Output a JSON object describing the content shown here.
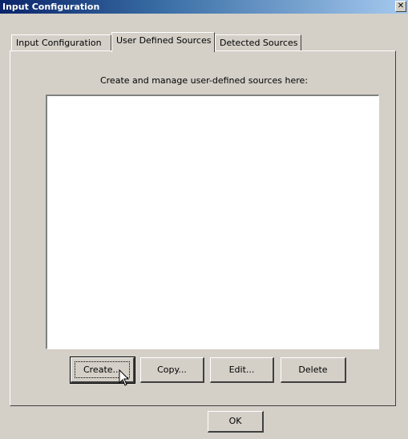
{
  "window": {
    "title": "Input Configuration",
    "close_glyph": "✕"
  },
  "tabs": [
    {
      "label": "Input Configuration",
      "active": false
    },
    {
      "label": "User Defined Sources",
      "active": true
    },
    {
      "label": "Detected Sources",
      "active": false
    }
  ],
  "panel": {
    "instruction": "Create and manage user-defined sources here:",
    "sources_list": []
  },
  "buttons": {
    "create": "Create...",
    "copy": "Copy...",
    "edit": "Edit...",
    "delete": "Delete",
    "ok": "OK"
  },
  "icons": {
    "close": "close-icon",
    "cursor": "mouse-pointer-icon"
  }
}
